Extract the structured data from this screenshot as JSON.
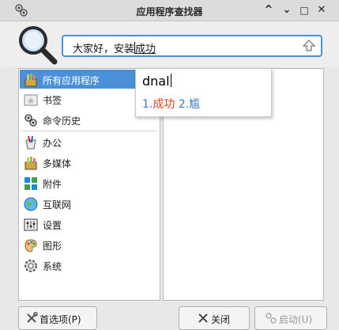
{
  "window": {
    "title": "应用程序查找器",
    "minimize_glyph": "^",
    "maximize_glyph": "⌄",
    "restore_glyph": "□",
    "close_glyph": "✕"
  },
  "search": {
    "value_before_caret": "大家好，安装",
    "value_after_caret": "成功"
  },
  "ime": {
    "input": "dnal",
    "candidates": [
      {
        "num": "1.",
        "text": "成功"
      },
      {
        "num": "2.",
        "text": "尴"
      }
    ]
  },
  "categories": [
    {
      "label": "所有应用程序",
      "icon": "all-apps-icon",
      "selected": true
    },
    {
      "label": "书签",
      "icon": "bookmark-folder-icon"
    },
    {
      "label": "命令历史",
      "icon": "command-history-icon"
    },
    {
      "label": "办公",
      "icon": "office-icon"
    },
    {
      "label": "多媒体",
      "icon": "multimedia-icon"
    },
    {
      "label": "附件",
      "icon": "accessories-icon"
    },
    {
      "label": "互联网",
      "icon": "internet-globe-icon"
    },
    {
      "label": "设置",
      "icon": "settings-icon"
    },
    {
      "label": "图形",
      "icon": "graphics-icon"
    },
    {
      "label": "系统",
      "icon": "system-gear-icon"
    }
  ],
  "buttons": {
    "preferences": "首选项(P)",
    "close": "关闭",
    "launch": "启动(U)"
  },
  "colors": {
    "selection": "#4a90d9",
    "ime_candidate_1": "#e0411a",
    "ime_candidate_2": "#3a7bc8"
  }
}
